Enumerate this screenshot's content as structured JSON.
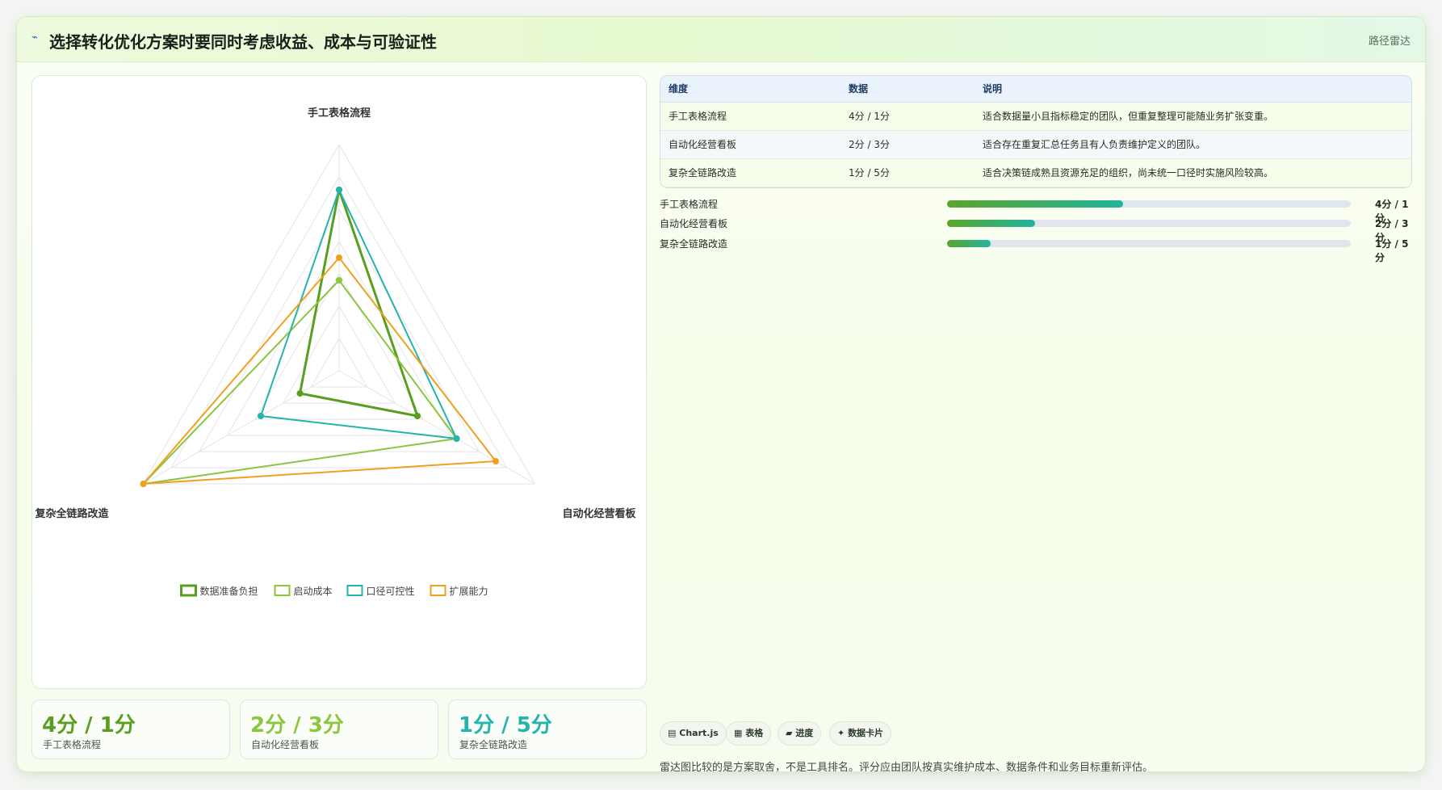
{
  "header": {
    "icon": "trend-line-icon",
    "title": "选择转化优化方案时要同时考虑收益、成本与可验证性",
    "badge": "路径雷达"
  },
  "chart_data": {
    "type": "radar",
    "categories": [
      "手工表格流程",
      "自动化经营看板",
      "复杂全链路改造"
    ],
    "scale_max": 5,
    "rings": 7,
    "series": [
      {
        "name": "数据准备负担",
        "color": "#5a9e1f",
        "values": [
          4,
          2,
          1
        ]
      },
      {
        "name": "启动成本",
        "color": "#8cc63f",
        "values": [
          2,
          3,
          5
        ]
      },
      {
        "name": "口径可控性",
        "color": "#25b3ad",
        "values": [
          4,
          3,
          2
        ]
      },
      {
        "name": "扩展能力",
        "color": "#f0a020",
        "values": [
          2.5,
          4,
          5
        ]
      }
    ],
    "legend_position": "bottom"
  },
  "kpis": [
    {
      "value": "4分 / 1分",
      "label": "手工表格流程",
      "color": "#5a9e1f"
    },
    {
      "value": "2分 / 3分",
      "label": "自动化经营看板",
      "color": "#8cc63f"
    },
    {
      "value": "1分 / 5分",
      "label": "复杂全链路改造",
      "color": "#25b3ad"
    }
  ],
  "table": {
    "headers": [
      "维度",
      "数据",
      "说明"
    ],
    "rows": [
      [
        "手工表格流程",
        "4分 / 1分",
        "适合数据量小且指标稳定的团队，但重复整理可能随业务扩张变重。"
      ],
      [
        "自动化经营看板",
        "2分 / 3分",
        "适合存在重复汇总任务且有人负责维护定义的团队。"
      ],
      [
        "复杂全链路改造",
        "1分 / 5分",
        "适合决策链成熟且资源充足的组织，尚未统一口径时实施风险较高。"
      ]
    ]
  },
  "progress": [
    {
      "label": "手工表格流程",
      "value": "4分 / 1分",
      "fraction": 0.435
    },
    {
      "label": "自动化经营看板",
      "value": "2分 / 3分",
      "fraction": 0.217
    },
    {
      "label": "复杂全链路改造",
      "value": "1分 / 5分",
      "fraction": 0.107
    }
  ],
  "chips": [
    {
      "icon": "chart-icon",
      "glyph": "▤",
      "label": "Chart.js"
    },
    {
      "icon": "table-icon",
      "glyph": "▦",
      "label": "表格"
    },
    {
      "icon": "progress-icon",
      "glyph": "▰",
      "label": "进度"
    },
    {
      "icon": "sparkle-icon",
      "glyph": "✦",
      "label": "数据卡片"
    }
  ],
  "footnote": "雷达图比较的是方案取舍，不是工具排名。评分应由团队按真实维护成本、数据条件和业务目标重新评估。"
}
